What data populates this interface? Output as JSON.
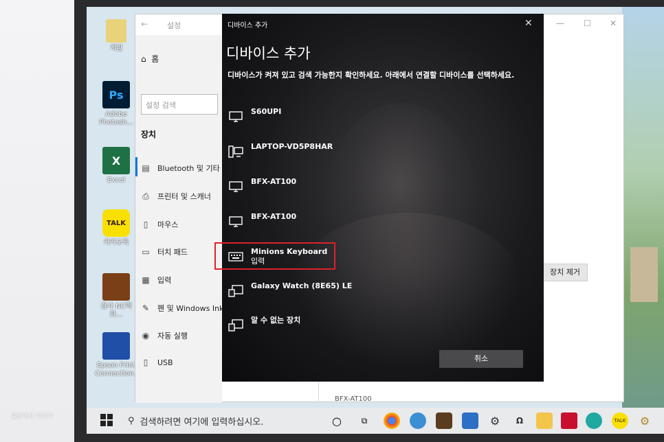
{
  "desktop": {
    "icons": [
      {
        "label": "게임",
        "icon": "folder-icon"
      },
      {
        "label": "Adobe Photosh...",
        "tile_text": "Ps",
        "icon": "photoshop-icon"
      },
      {
        "label": "Excel",
        "tile_text": "X",
        "icon": "excel-icon"
      },
      {
        "label": "카카오톡",
        "tile_text": "TALK",
        "icon": "kakaotalk-icon"
      },
      {
        "label": "검사 NC백화...",
        "icon": "game-icon"
      },
      {
        "label": "Epson Print Connection...",
        "icon": "epson-icon"
      }
    ]
  },
  "settings": {
    "title": "설정",
    "home": "홈",
    "search_placeholder": "설정 검색",
    "section": "장치",
    "nav": [
      {
        "label": "Bluetooth 및 기타",
        "icon": "bluetooth-icon"
      },
      {
        "label": "프린터 및 스캐너",
        "icon": "printer-icon"
      },
      {
        "label": "마우스",
        "icon": "mouse-icon"
      },
      {
        "label": "터치 패드",
        "icon": "touchpad-icon"
      },
      {
        "label": "입력",
        "icon": "keyboard-icon"
      },
      {
        "label": "펜 및 Windows Ink",
        "icon": "pen-icon"
      },
      {
        "label": "자동 실행",
        "icon": "autoplay-icon"
      },
      {
        "label": "USB",
        "icon": "usb-icon"
      }
    ],
    "remove_device": "장치 제거",
    "behind_item": "BFX-AT100"
  },
  "dialog": {
    "caption": "디바이스 추가",
    "heading": "디바이스 추가",
    "description": "디바이스가 켜져 있고 검색 가능한지 확인하세요. 아래에서 연결할 디바이스를 선택하세요.",
    "devices": [
      {
        "name": "S60UPI",
        "sub": "",
        "icon": "monitor-icon"
      },
      {
        "name": "LAPTOP-VD5P8HAR",
        "sub": "",
        "icon": "computer-icon"
      },
      {
        "name": "BFX-AT100",
        "sub": "",
        "icon": "monitor-icon"
      },
      {
        "name": "BFX-AT100",
        "sub": "",
        "icon": "monitor-icon"
      },
      {
        "name": "Minions Keyboard",
        "sub": "입력",
        "icon": "keyboard-icon"
      },
      {
        "name": "Galaxy Watch (8E65) LE",
        "sub": "",
        "icon": "device-icon"
      },
      {
        "name": "알 수 없는 장치",
        "sub": "",
        "icon": "device-icon"
      }
    ],
    "cancel": "취소"
  },
  "taskbar": {
    "search_placeholder": "검색하려면 여기에 입력하십시오.",
    "icons": [
      "cortana-icon",
      "task-view-icon",
      "chrome-icon",
      "edge-icon",
      "store-icon",
      "mail-icon",
      "settings-icon",
      "search-app-icon",
      "folder-icon",
      "mcafee-icon",
      "edge-new-icon",
      "kakaotalk-icon",
      "gear-icon"
    ]
  },
  "watermark": "일상에서 이야기"
}
